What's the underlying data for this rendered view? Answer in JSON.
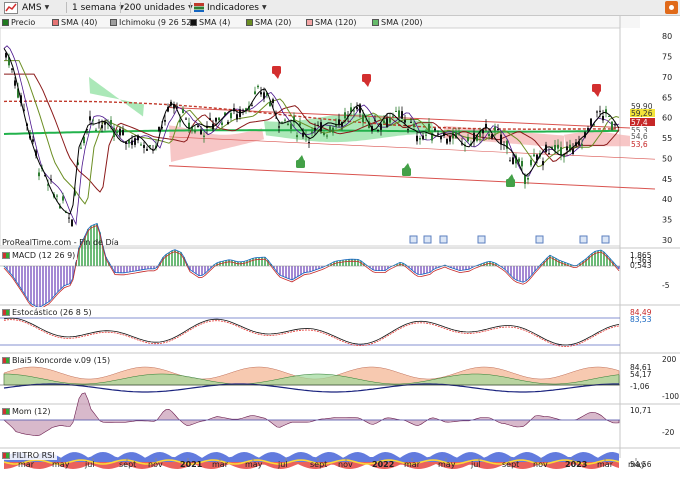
{
  "toolbar": {
    "symbol": "AMS",
    "timeframe": "1 semana",
    "units": "200 unidades",
    "indicators": "Indicadores"
  },
  "legend": [
    {
      "label": "Precio",
      "color": "#1f7a1f"
    },
    {
      "label": "SMA (40)",
      "color": "#e57373"
    },
    {
      "label": "Ichimoku (9 26 52)",
      "color": "#9e9e9e"
    },
    {
      "label": "SMA (4)",
      "color": "#111111"
    },
    {
      "label": "SMA (20)",
      "color": "#6b8e23"
    },
    {
      "label": "SMA (120)",
      "color": "#f4a6a6"
    },
    {
      "label": "SMA (200)",
      "color": "#66bb6a"
    }
  ],
  "credit": "ProRealTime.com - Fin de Día",
  "price_axis": {
    "ticks": [
      "80",
      "75",
      "70",
      "65",
      "60",
      "55",
      "50",
      "45",
      "40",
      "35",
      "30"
    ]
  },
  "price_tags": [
    {
      "text": "59,90",
      "bg": "#ffffff",
      "fg": "#333333"
    },
    {
      "text": "59,26",
      "bg": "#f2e33a",
      "fg": "#333333"
    },
    {
      "text": "57,4",
      "bg": "#c62828",
      "fg": "#ffffff"
    },
    {
      "text": "55,3",
      "bg": "#ffffff",
      "fg": "#555555"
    },
    {
      "text": "54,6",
      "bg": "#ffffff",
      "fg": "#555555"
    },
    {
      "text": "53,6",
      "bg": "#ffffff",
      "fg": "#c62828"
    }
  ],
  "panels": {
    "macd": {
      "title": "MACD (12 26 9)",
      "ticks": [
        "1,865",
        "1,363",
        "0,543",
        "-5"
      ]
    },
    "stoch": {
      "title": "Estocástico (26 8 5)",
      "ticks": [
        "84,49",
        "83,53"
      ]
    },
    "koncorde": {
      "title": "Blai5 Koncorde v.09 (15)",
      "ticks": [
        "200",
        "84,61",
        "54,17",
        "-1,06",
        "-100"
      ]
    },
    "mom": {
      "title": "Mom (12)",
      "ticks": [
        "10,71",
        "-20"
      ]
    },
    "rsi": {
      "title": "FILTRO RSI",
      "ticks": [
        "54,56"
      ]
    }
  },
  "time_axis": [
    {
      "label": "mar",
      "bold": false
    },
    {
      "label": "may",
      "bold": false
    },
    {
      "label": "jul",
      "bold": false
    },
    {
      "label": "sept",
      "bold": false
    },
    {
      "label": "nov",
      "bold": false
    },
    {
      "label": "2021",
      "bold": true
    },
    {
      "label": "mar",
      "bold": false
    },
    {
      "label": "may",
      "bold": false
    },
    {
      "label": "jul",
      "bold": false
    },
    {
      "label": "sept",
      "bold": false
    },
    {
      "label": "nov",
      "bold": false
    },
    {
      "label": "2022",
      "bold": true
    },
    {
      "label": "mar",
      "bold": false
    },
    {
      "label": "may",
      "bold": false
    },
    {
      "label": "jul",
      "bold": false
    },
    {
      "label": "sept",
      "bold": false
    },
    {
      "label": "nov",
      "bold": false
    },
    {
      "label": "2023",
      "bold": true
    },
    {
      "label": "mar",
      "bold": false
    },
    {
      "label": "may",
      "bold": false
    }
  ],
  "colors": {
    "bull": "#2e7d32",
    "bear": "#111111",
    "channel": "#d9534f",
    "cloud_green": "#8fe0a0",
    "cloud_red": "#f4b3b3",
    "sell_signal": "#d32f2f",
    "buy_signal": "#43a047"
  }
}
